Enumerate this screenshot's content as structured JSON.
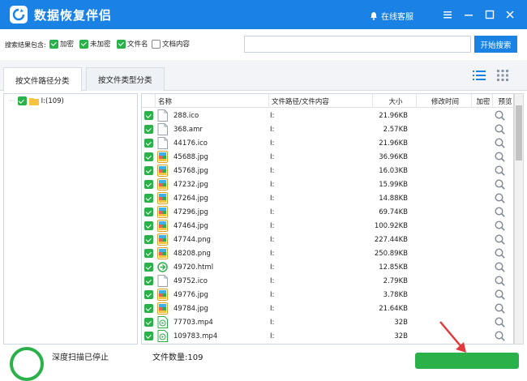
{
  "app": {
    "title": "数据恢复伴侣",
    "customer_service": "在线客服"
  },
  "search": {
    "label": "搜索结果包含:",
    "options": [
      {
        "label": "加密",
        "checked": true
      },
      {
        "label": "未加密",
        "checked": true
      },
      {
        "label": "文件名",
        "checked": true
      },
      {
        "label": "文档内容",
        "checked": false
      }
    ],
    "placeholder": "",
    "button": "开始搜索"
  },
  "tabs": [
    {
      "label": "按文件路径分类",
      "active": true
    },
    {
      "label": "按文件类型分类",
      "active": false
    }
  ],
  "tree": {
    "root": "I:(109)"
  },
  "table": {
    "columns": [
      "名称",
      "文件路径/文件内容",
      "大小",
      "修改时间",
      "加密",
      "预览"
    ],
    "rows": [
      {
        "name": "288.ico",
        "path": "I:",
        "size": "21.96KB",
        "icon": "blank"
      },
      {
        "name": "368.amr",
        "path": "I:",
        "size": "2.57KB",
        "icon": "blank"
      },
      {
        "name": "44176.ico",
        "path": "I:",
        "size": "21.96KB",
        "icon": "blank"
      },
      {
        "name": "45688.jpg",
        "path": "I:",
        "size": "36.96KB",
        "icon": "image"
      },
      {
        "name": "45768.jpg",
        "path": "I:",
        "size": "16.03KB",
        "icon": "image"
      },
      {
        "name": "47232.jpg",
        "path": "I:",
        "size": "15.99KB",
        "icon": "image"
      },
      {
        "name": "47264.jpg",
        "path": "I:",
        "size": "14.88KB",
        "icon": "image"
      },
      {
        "name": "47296.jpg",
        "path": "I:",
        "size": "69.74KB",
        "icon": "image"
      },
      {
        "name": "47464.jpg",
        "path": "I:",
        "size": "100.92KB",
        "icon": "image"
      },
      {
        "name": "47744.png",
        "path": "I:",
        "size": "227.44KB",
        "icon": "image"
      },
      {
        "name": "48208.png",
        "path": "I:",
        "size": "250.89KB",
        "icon": "image"
      },
      {
        "name": "49720.html",
        "path": "I:",
        "size": "12.85KB",
        "icon": "html"
      },
      {
        "name": "49752.ico",
        "path": "I:",
        "size": "2.79KB",
        "icon": "blank"
      },
      {
        "name": "49776.jpg",
        "path": "I:",
        "size": "3.78KB",
        "icon": "image"
      },
      {
        "name": "49784.jpg",
        "path": "I:",
        "size": "21.64KB",
        "icon": "image"
      },
      {
        "name": "77703.mp4",
        "path": "I:",
        "size": "32B",
        "icon": "video"
      },
      {
        "name": "109783.mp4",
        "path": "I:",
        "size": "32B",
        "icon": "video"
      }
    ]
  },
  "status": {
    "text": "深度扫描已停止",
    "file_count": "文件数量:109"
  },
  "colors": {
    "accent": "#1a82e5",
    "green": "#2bb14a",
    "arrow": "#e23a3a"
  }
}
